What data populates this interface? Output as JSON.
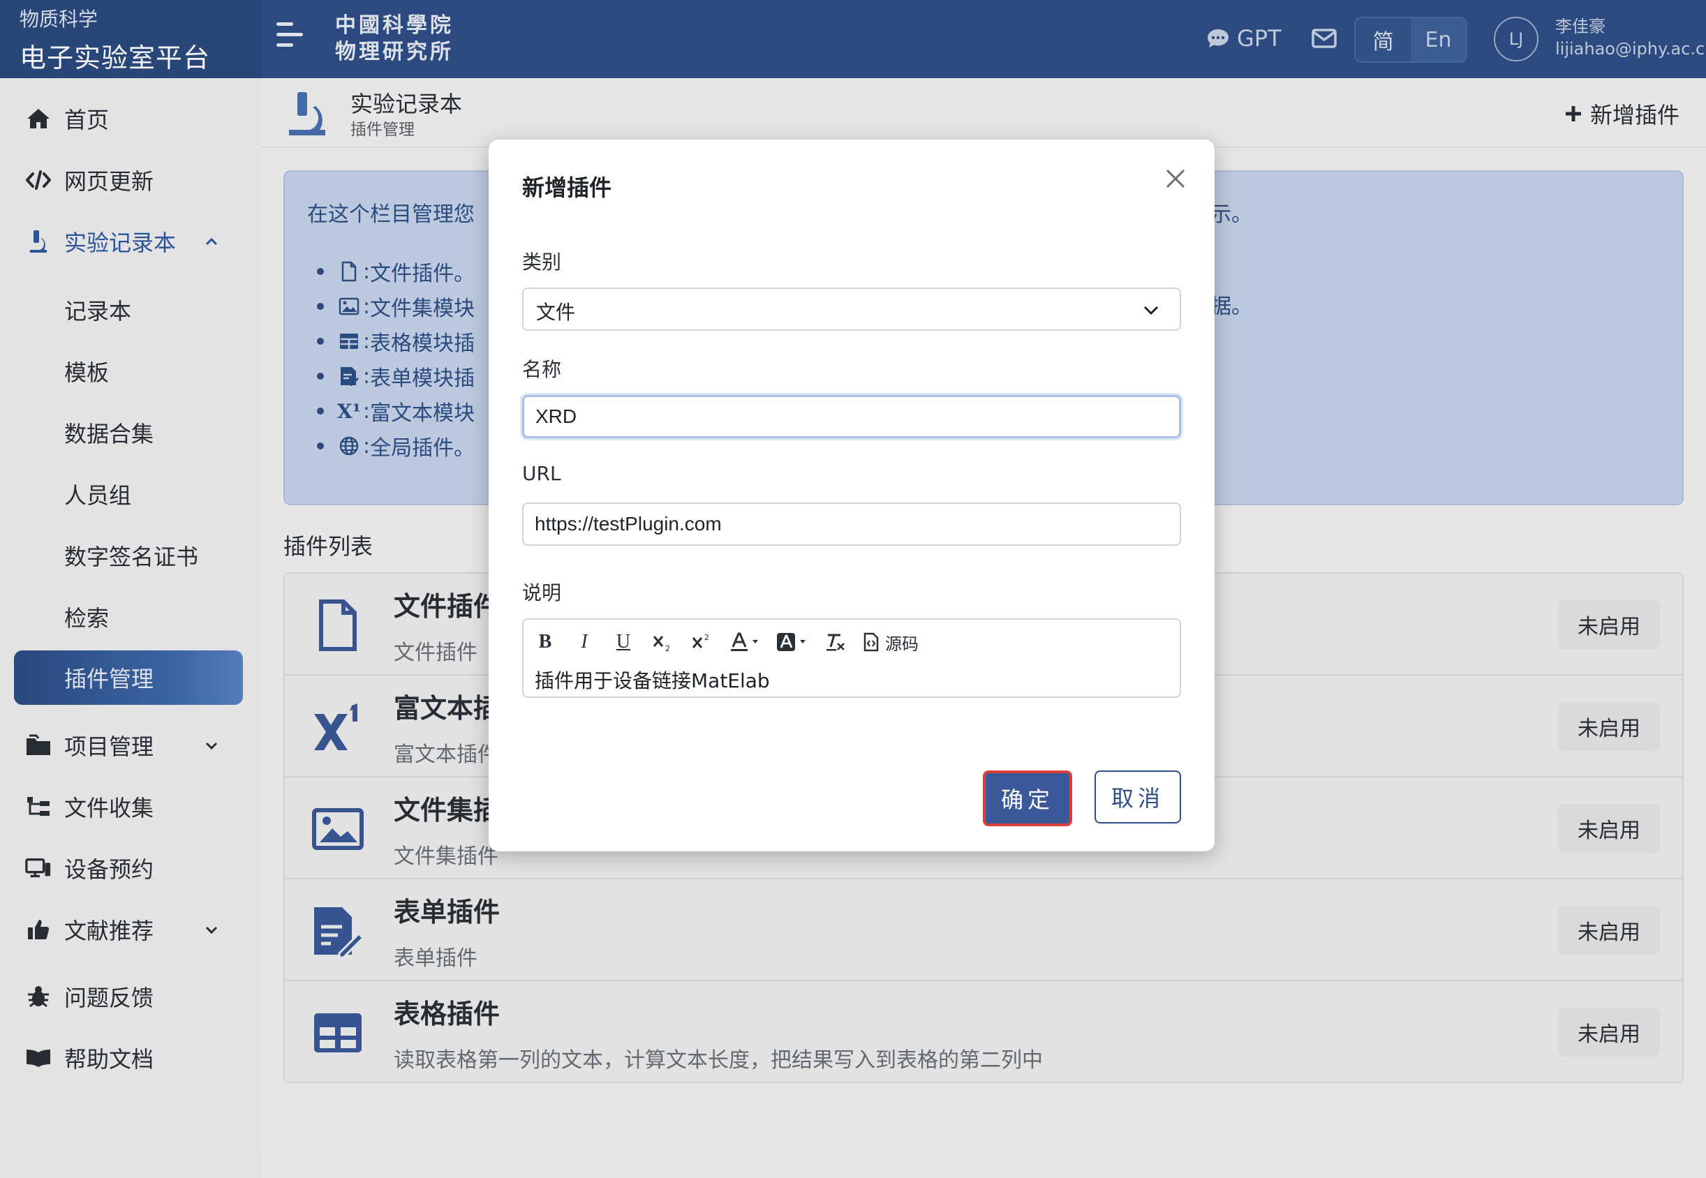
{
  "header": {
    "brand_sub": "物质科学",
    "brand_main": "电子实验室平台",
    "institution_line1": "中國科學院",
    "institution_line2": "物理研究所",
    "gpt_label": "GPT",
    "lang_zh": "简",
    "lang_en": "En",
    "avatar_initials": "LJ",
    "user_name": "李佳豪",
    "user_email": "lijiahao@iphy.ac.cn"
  },
  "sidebar": {
    "items": [
      {
        "label": "首页",
        "icon": "home-icon"
      },
      {
        "label": "网页更新",
        "icon": "code-icon"
      },
      {
        "label": "实验记录本",
        "icon": "microscope-icon"
      },
      {
        "label": "记录本"
      },
      {
        "label": "模板"
      },
      {
        "label": "数据合集"
      },
      {
        "label": "人员组"
      },
      {
        "label": "数字签名证书"
      },
      {
        "label": "检索"
      },
      {
        "label": "插件管理"
      },
      {
        "label": "项目管理",
        "icon": "folder-icon"
      },
      {
        "label": "文件收集",
        "icon": "sitemap-icon"
      },
      {
        "label": "设备预约",
        "icon": "devices-icon"
      },
      {
        "label": "文献推荐",
        "icon": "thumbs-up-icon"
      },
      {
        "label": "问题反馈",
        "icon": "bug-icon"
      },
      {
        "label": "帮助文档",
        "icon": "book-icon"
      }
    ]
  },
  "page": {
    "title": "实验记录本",
    "subtitle": "插件管理",
    "add_button": "新增插件"
  },
  "info": {
    "intro": "在这个栏目管理您",
    "intro_tail": "示。",
    "tail_b": "据。",
    "items": [
      "文件插件。",
      "文件集模块",
      "表格模块插",
      "表单模块插",
      "富文本模块",
      "全局插件。"
    ]
  },
  "plugin_list": {
    "heading": "插件列表",
    "rows": [
      {
        "name": "文件插件",
        "desc": "文件插件",
        "status": "未启用"
      },
      {
        "name": "富文本插",
        "desc": "富文本插件",
        "status": "未启用"
      },
      {
        "name": "文件集插",
        "desc": "文件集插件",
        "status": "未启用"
      },
      {
        "name": "表单插件",
        "desc": "表单插件",
        "status": "未启用"
      },
      {
        "name": "表格插件",
        "desc": "读取表格第一列的文本，计算文本长度，把结果写入到表格的第二列中",
        "status": "未启用"
      }
    ]
  },
  "modal": {
    "title": "新增插件",
    "category_label": "类别",
    "category_value": "文件",
    "name_label": "名称",
    "name_value": "XRD",
    "url_label": "URL",
    "url_value": "https://testPlugin.com",
    "desc_label": "说明",
    "toolbar": {
      "bold": "B",
      "italic": "I",
      "underline": "U",
      "source": "源码"
    },
    "editor_text": "插件用于设备链接MatElab",
    "ok_label": "确定",
    "cancel_label": "取消"
  },
  "colors": {
    "header_bg": "#2f4f86",
    "accent": "#3b5998",
    "info_bg": "#c7d4ea",
    "highlight_border": "#d9413a"
  }
}
